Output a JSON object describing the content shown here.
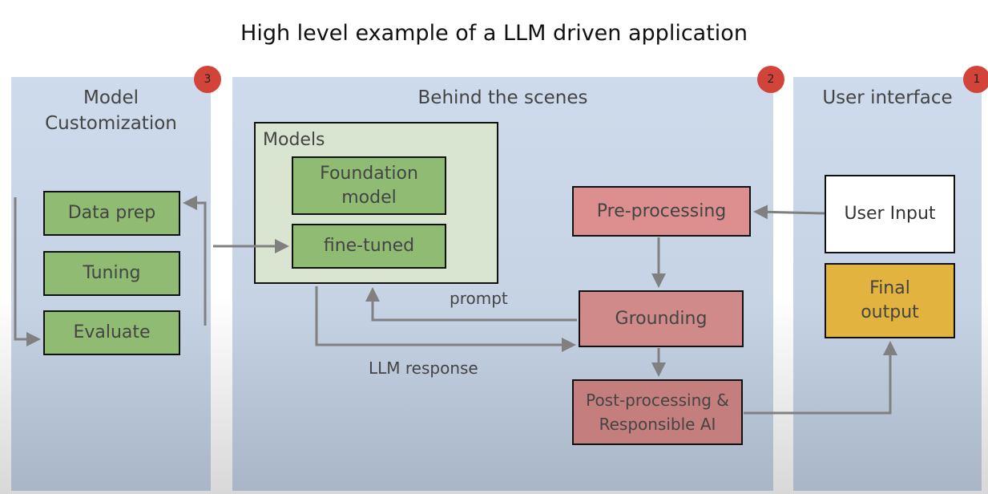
{
  "title": "High level example of a LLM driven application",
  "panels": {
    "customization": {
      "title_line1": "Model",
      "title_line2": "Customization",
      "badge": "3"
    },
    "behind": {
      "title": "Behind the scenes",
      "badge": "2"
    },
    "ui": {
      "title": "User interface",
      "badge": "1"
    }
  },
  "customization": {
    "data_prep": "Data prep",
    "tuning": "Tuning",
    "evaluate": "Evaluate"
  },
  "models": {
    "label": "Models",
    "foundation": "Foundation model",
    "fine_tuned": "fine-tuned"
  },
  "pipeline": {
    "pre": "Pre-processing",
    "grounding": "Grounding",
    "post": "Post-processing & Responsible AI"
  },
  "ui": {
    "user_input": "User Input",
    "final_output": "Final output"
  },
  "edges": {
    "prompt": "prompt",
    "llm_response": "LLM response"
  },
  "colors": {
    "arrow": "#808080",
    "badge": "#d2443a",
    "green": "#8fbb73",
    "pink": "#d68c8b",
    "gold": "#e3b33f"
  }
}
